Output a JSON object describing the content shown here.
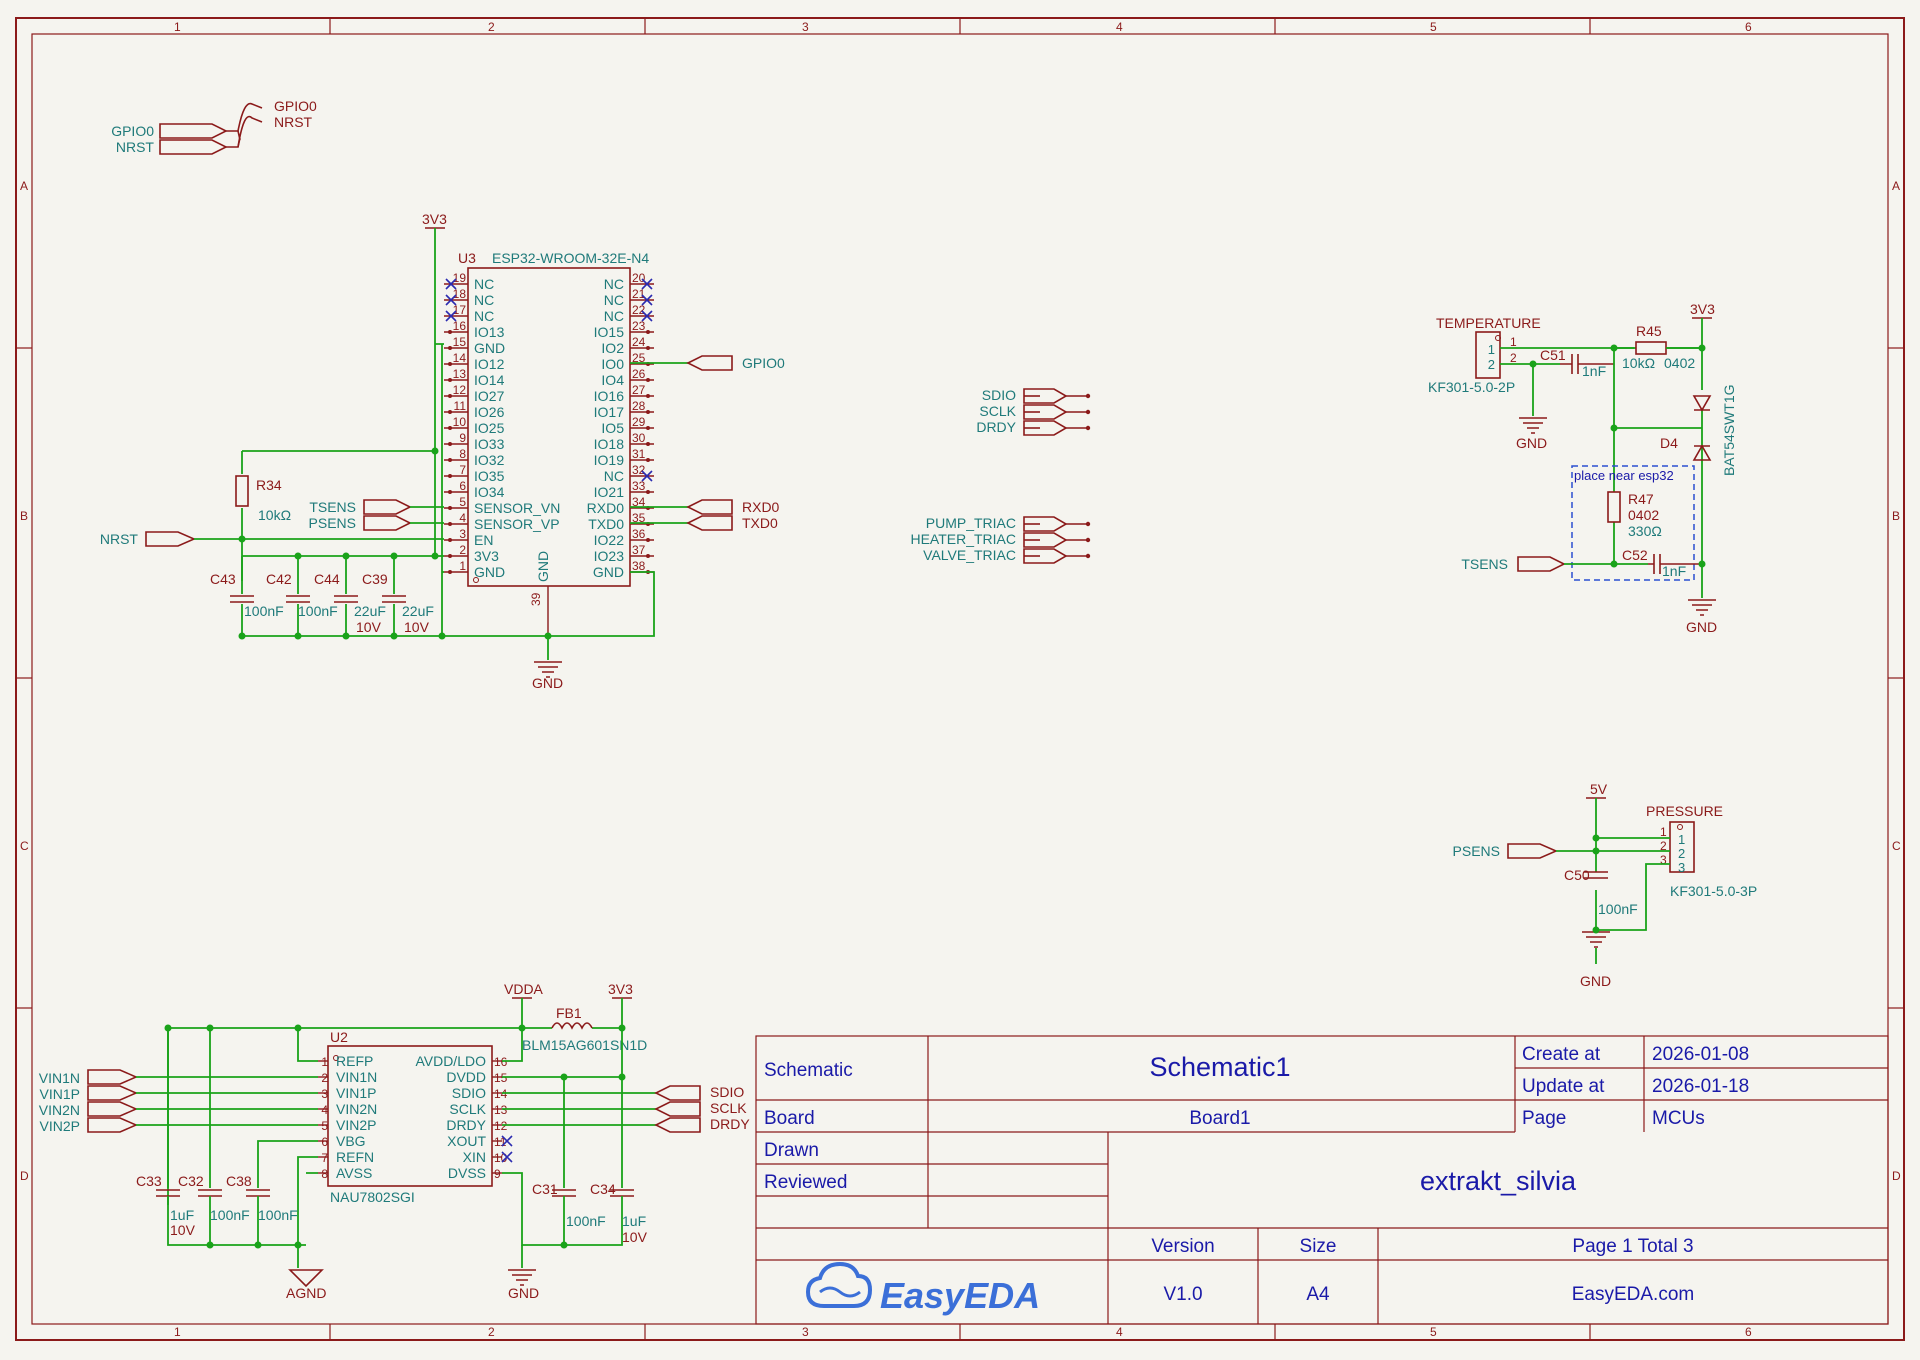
{
  "ruler": {
    "cols": [
      "1",
      "2",
      "3",
      "4",
      "5",
      "6"
    ],
    "rows": [
      "A",
      "B",
      "C",
      "D"
    ]
  },
  "title_block": {
    "sheet_label": "Schematic",
    "sheet_name": "Schematic1",
    "create_label": "Create at",
    "create_date": "2026-01-08",
    "update_label": "Update at",
    "update_date": "2026-01-18",
    "board_label": "Board",
    "board_name": "Board1",
    "page_label": "Page",
    "page_name": "MCUs",
    "drawn_label": "Drawn",
    "reviewed_label": "Reviewed",
    "project": "extrakt_silvia",
    "version_label": "Version",
    "version": "V1.0",
    "size_label": "Size",
    "size": "A4",
    "page_info": "Page  1  Total  3",
    "logo_text": "EasyEDA",
    "site": "EasyEDA.com"
  },
  "top_left": {
    "in_gpio0": "GPIO0",
    "in_nrst": "NRST",
    "out_gpio0": "GPIO0",
    "out_nrst": "NRST"
  },
  "esp32": {
    "ref": "U3",
    "part": "ESP32-WROOM-32E-N4",
    "power_3v3": "3V3",
    "gnd": "GND",
    "gnd_vertical": "GND",
    "pin39": "39",
    "left_pins": [
      {
        "num": "19",
        "name": "NC"
      },
      {
        "num": "18",
        "name": "NC"
      },
      {
        "num": "17",
        "name": "NC"
      },
      {
        "num": "16",
        "name": "IO13"
      },
      {
        "num": "15",
        "name": "GND"
      },
      {
        "num": "14",
        "name": "IO12"
      },
      {
        "num": "13",
        "name": "IO14"
      },
      {
        "num": "12",
        "name": "IO27"
      },
      {
        "num": "11",
        "name": "IO26"
      },
      {
        "num": "10",
        "name": "IO25"
      },
      {
        "num": "9",
        "name": "IO33"
      },
      {
        "num": "8",
        "name": "IO32"
      },
      {
        "num": "7",
        "name": "IO35"
      },
      {
        "num": "6",
        "name": "IO34"
      },
      {
        "num": "5",
        "name": "SENSOR_VN"
      },
      {
        "num": "4",
        "name": "SENSOR_VP"
      },
      {
        "num": "3",
        "name": "EN"
      },
      {
        "num": "2",
        "name": "3V3"
      },
      {
        "num": "1",
        "name": "GND"
      }
    ],
    "right_pins": [
      {
        "num": "20",
        "name": "NC"
      },
      {
        "num": "21",
        "name": "NC"
      },
      {
        "num": "22",
        "name": "NC"
      },
      {
        "num": "23",
        "name": "IO15"
      },
      {
        "num": "24",
        "name": "IO2"
      },
      {
        "num": "25",
        "name": "IO0"
      },
      {
        "num": "26",
        "name": "IO4"
      },
      {
        "num": "27",
        "name": "IO16"
      },
      {
        "num": "28",
        "name": "IO17"
      },
      {
        "num": "29",
        "name": "IO5"
      },
      {
        "num": "30",
        "name": "IO18"
      },
      {
        "num": "31",
        "name": "IO19"
      },
      {
        "num": "32",
        "name": "NC"
      },
      {
        "num": "33",
        "name": "IO21"
      },
      {
        "num": "34",
        "name": "RXD0"
      },
      {
        "num": "35",
        "name": "TXD0"
      },
      {
        "num": "36",
        "name": "IO22"
      },
      {
        "num": "37",
        "name": "IO23"
      },
      {
        "num": "38",
        "name": "GND"
      }
    ],
    "net_gpio0": "GPIO0",
    "net_rxd0": "RXD0",
    "net_txd0": "TXD0",
    "net_tsens": "TSENS",
    "net_psens": "PSENS",
    "net_nrst": "NRST",
    "r34_ref": "R34",
    "r34_val": "10kΩ",
    "caps": [
      {
        "ref": "C43",
        "val": "100nF",
        "v": ""
      },
      {
        "ref": "C42",
        "val": "100nF",
        "v": ""
      },
      {
        "ref": "C44",
        "val": "22uF",
        "v": "10V"
      },
      {
        "ref": "C39",
        "val": "22uF",
        "v": "10V"
      }
    ]
  },
  "mid_ports": {
    "group1": [
      "SDIO",
      "SCLK",
      "DRDY"
    ],
    "group2": [
      "PUMP_TRIAC",
      "HEATER_TRIAC",
      "VALVE_TRIAC"
    ]
  },
  "temperature": {
    "conn_name": "TEMPERATURE",
    "conn_part": "KF301-5.0-2P",
    "pin1": "1",
    "pin2": "2",
    "gnd": "GND",
    "power": "3V3",
    "c51_ref": "C51",
    "c51_val": "1nF",
    "r45_ref": "R45",
    "r45_val": "10kΩ",
    "r45_pkg": "0402",
    "d4_ref": "D4",
    "d4_part": "BAT54SWT1G",
    "note": "place near esp32",
    "r47_ref": "R47",
    "r47_pkg": "0402",
    "r47_val": "330Ω",
    "c52_ref": "C52",
    "c52_val": "1nF",
    "net_tsens": "TSENS",
    "gnd2": "GND"
  },
  "pressure": {
    "conn_name": "PRESSURE",
    "conn_part": "KF301-5.0-3P",
    "pins": [
      "1",
      "2",
      "3"
    ],
    "power": "5V",
    "net_psens": "PSENS",
    "c50_ref": "C50",
    "c50_val": "100nF",
    "gnd": "GND"
  },
  "nau": {
    "ref": "U2",
    "part": "NAU7802SGI",
    "vdda": "VDDA",
    "power_3v3": "3V3",
    "fb_ref": "FB1",
    "fb_part": "BLM15AG601SN1D",
    "left_pins": [
      {
        "num": "1",
        "name": "REFP"
      },
      {
        "num": "2",
        "name": "VIN1N"
      },
      {
        "num": "3",
        "name": "VIN1P"
      },
      {
        "num": "4",
        "name": "VIN2N"
      },
      {
        "num": "5",
        "name": "VIN2P"
      },
      {
        "num": "6",
        "name": "VBG"
      },
      {
        "num": "7",
        "name": "REFN"
      },
      {
        "num": "8",
        "name": "AVSS"
      }
    ],
    "right_pins": [
      {
        "num": "16",
        "name": "AVDD/LDO"
      },
      {
        "num": "15",
        "name": "DVDD"
      },
      {
        "num": "14",
        "name": "SDIO"
      },
      {
        "num": "13",
        "name": "SCLK"
      },
      {
        "num": "12",
        "name": "DRDY"
      },
      {
        "num": "11",
        "name": "XOUT"
      },
      {
        "num": "10",
        "name": "XIN"
      },
      {
        "num": "9",
        "name": "DVSS"
      }
    ],
    "inputs": [
      "VIN1N",
      "VIN1P",
      "VIN2N",
      "VIN2P"
    ],
    "outputs": [
      "SDIO",
      "SCLK",
      "DRDY"
    ],
    "agnd": "AGND",
    "gnd": "GND",
    "caps_left": [
      {
        "ref": "C33",
        "val": "1uF",
        "v": "10V"
      },
      {
        "ref": "C32",
        "val": "100nF",
        "v": ""
      },
      {
        "ref": "C38",
        "val": "100nF",
        "v": ""
      }
    ],
    "caps_right": [
      {
        "ref": "C31",
        "val": "100nF",
        "v": ""
      },
      {
        "ref": "C34",
        "val": "1uF",
        "v": "10V"
      }
    ]
  }
}
